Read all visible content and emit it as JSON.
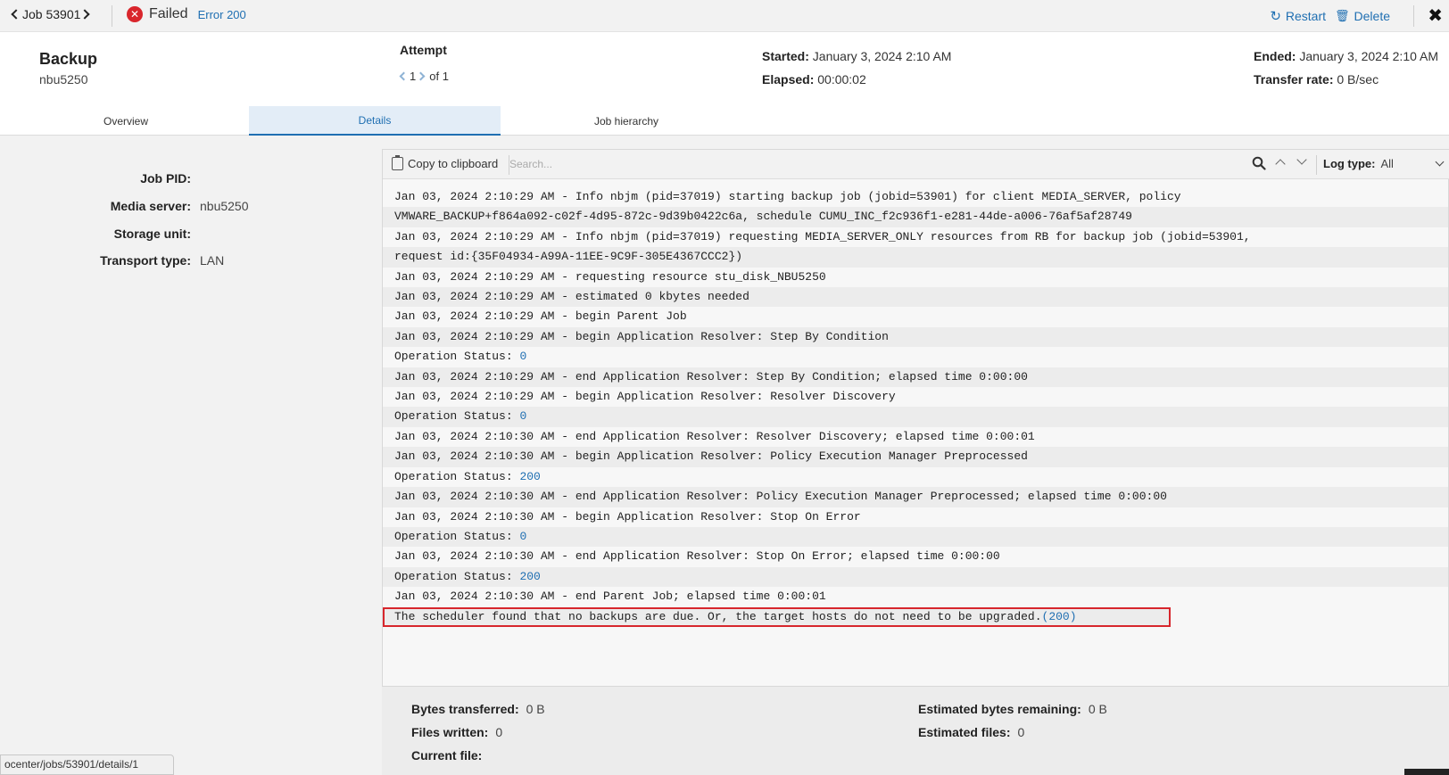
{
  "topbar": {
    "job_label": "Job 53901",
    "status": "Failed",
    "error": "Error 200",
    "restart_label": "Restart",
    "delete_label": "Delete",
    "close_symbol": "✖"
  },
  "header": {
    "job_type": "Backup",
    "client": "nbu5250",
    "attempt_title": "Attempt",
    "attempt_current": "1",
    "attempt_of": "of 1",
    "started_label": "Started:",
    "started_value": "January 3, 2024 2:10 AM",
    "elapsed_label": "Elapsed:",
    "elapsed_value": "00:00:02",
    "ended_label": "Ended:",
    "ended_value": "January 3, 2024 2:10 AM",
    "transfer_label": "Transfer rate:",
    "transfer_value": "0 B/sec"
  },
  "tabs": [
    {
      "label": "Overview",
      "active": false
    },
    {
      "label": "Details",
      "active": true
    },
    {
      "label": "Job hierarchy",
      "active": false
    }
  ],
  "details": {
    "job_pid_label": "Job PID:",
    "job_pid_value": "",
    "media_server_label": "Media server:",
    "media_server_value": "nbu5250",
    "storage_unit_label": "Storage unit:",
    "storage_unit_value": "",
    "transport_label": "Transport type:",
    "transport_value": "LAN"
  },
  "log_toolbar": {
    "copy_label": "Copy to clipboard",
    "search_placeholder": "Search...",
    "log_type_label": "Log type:",
    "log_type_value": "All"
  },
  "log_lines": [
    {
      "text": "Jan 03, 2024 2:10:29 AM - Info nbjm (pid=37019) starting backup job (jobid=53901) for client MEDIA_SERVER, policy",
      "num": ""
    },
    {
      "text": "VMWARE_BACKUP+f864a092-c02f-4d95-872c-9d39b0422c6a, schedule CUMU_INC_f2c936f1-e281-44de-a006-76af5af28749",
      "num": ""
    },
    {
      "text": "Jan 03, 2024 2:10:29 AM - Info nbjm (pid=37019) requesting MEDIA_SERVER_ONLY resources from RB for backup job (jobid=53901,",
      "num": ""
    },
    {
      "text": "request id:{35F04934-A99A-11EE-9C9F-305E4367CCC2})",
      "num": ""
    },
    {
      "text": "Jan 03, 2024 2:10:29 AM - requesting resource stu_disk_NBU5250",
      "num": ""
    },
    {
      "text": "Jan 03, 2024 2:10:29 AM - estimated 0 kbytes needed",
      "num": ""
    },
    {
      "text": "Jan 03, 2024 2:10:29 AM - begin Parent Job",
      "num": ""
    },
    {
      "text": "Jan 03, 2024 2:10:29 AM - begin Application Resolver: Step By Condition",
      "num": ""
    },
    {
      "text": "Operation Status: ",
      "num": "0"
    },
    {
      "text": "Jan 03, 2024 2:10:29 AM - end Application Resolver: Step By Condition; elapsed time 0:00:00",
      "num": ""
    },
    {
      "text": "Jan 03, 2024 2:10:29 AM - begin Application Resolver: Resolver Discovery",
      "num": ""
    },
    {
      "text": "Operation Status: ",
      "num": "0"
    },
    {
      "text": "Jan 03, 2024 2:10:30 AM - end Application Resolver: Resolver Discovery; elapsed time 0:00:01",
      "num": ""
    },
    {
      "text": "Jan 03, 2024 2:10:30 AM - begin Application Resolver: Policy Execution Manager Preprocessed",
      "num": ""
    },
    {
      "text": "Operation Status: ",
      "num": "200"
    },
    {
      "text": "Jan 03, 2024 2:10:30 AM - end Application Resolver: Policy Execution Manager Preprocessed; elapsed time 0:00:00",
      "num": ""
    },
    {
      "text": "Jan 03, 2024 2:10:30 AM - begin Application Resolver: Stop On Error",
      "num": ""
    },
    {
      "text": "Operation Status: ",
      "num": "0"
    },
    {
      "text": "Jan 03, 2024 2:10:30 AM - end Application Resolver: Stop On Error; elapsed time 0:00:00",
      "num": ""
    },
    {
      "text": "Operation Status: ",
      "num": "200"
    },
    {
      "text": "Jan 03, 2024 2:10:30 AM - end Parent Job; elapsed time 0:00:01",
      "num": ""
    },
    {
      "text": "The scheduler found that no backups are due. Or, the target hosts do not need to be upgraded.",
      "num": "(200)",
      "highlight": true
    }
  ],
  "stats": {
    "bytes_transferred_label": "Bytes transferred:",
    "bytes_transferred_value": "0 B",
    "files_written_label": "Files written:",
    "files_written_value": "0",
    "current_file_label": "Current file:",
    "current_file_value": "",
    "est_bytes_label": "Estimated bytes remaining:",
    "est_bytes_value": "0 B",
    "est_files_label": "Estimated files:",
    "est_files_value": "0"
  },
  "status_url": "ocenter/jobs/53901/details/1",
  "colors": {
    "accent": "#1f6fb2",
    "error": "#d9262c",
    "highlight_border": "#d7262c"
  }
}
